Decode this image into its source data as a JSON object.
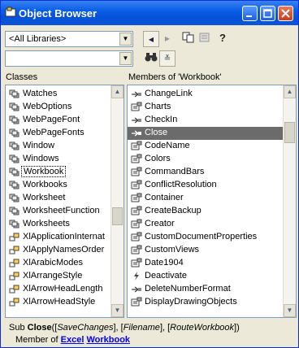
{
  "window": {
    "title": "Object Browser",
    "app_icon": "object-browser-icon"
  },
  "toolbar": {
    "library_value": "<All Libraries>",
    "search_value": "",
    "nav_back": "◀",
    "nav_forward": "▶",
    "copy_icon": "copy-icon",
    "view_definition_icon": "view-definition-icon",
    "help_icon": "help-icon",
    "help_glyph": "?",
    "search_glyph": "🔭",
    "toggle_glyph": "≚"
  },
  "classes": {
    "header": "Classes",
    "items": [
      "Watches",
      "WebOptions",
      "WebPageFont",
      "WebPageFonts",
      "Window",
      "Windows",
      "Workbook",
      "Workbooks",
      "Worksheet",
      "WorksheetFunction",
      "Worksheets",
      "XlApplicationInternat",
      "XlApplyNamesOrder",
      "XlArabicModes",
      "XlArrangeStyle",
      "XlArrowHeadLength",
      "XlArrowHeadStyle"
    ]
  },
  "members": {
    "header": "Members of 'Workbook'",
    "items": [
      "ChangeLink",
      "Charts",
      "CheckIn",
      "Close",
      "CodeName",
      "Colors",
      "CommandBars",
      "ConflictResolution",
      "Container",
      "CreateBackup",
      "Creator",
      "CustomDocumentProperties",
      "CustomViews",
      "Date1904",
      "Deactivate",
      "DeleteNumberFormat",
      "DisplayDrawingObjects"
    ],
    "selected": "Close"
  },
  "details": {
    "prefix": "Sub ",
    "name": "Close",
    "param1": "SaveChanges",
    "param2": "Filename",
    "param3": "RouteWorkbook",
    "member_of_label": "Member of ",
    "library_link": "Excel",
    "class_link": "Workbook"
  }
}
